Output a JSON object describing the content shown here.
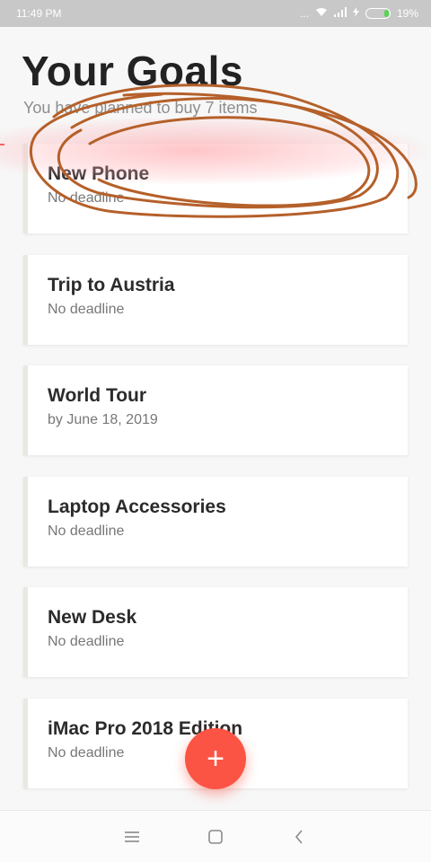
{
  "status_bar": {
    "time": "11:49 PM",
    "dots": "...",
    "battery_percent": "19%",
    "battery_level": 0.19
  },
  "header": {
    "title": "Your Goals",
    "subtitle": "You have planned to buy 7 items"
  },
  "goals": [
    {
      "title": "New Phone",
      "deadline": "No deadline"
    },
    {
      "title": "Trip to Austria",
      "deadline": "No deadline"
    },
    {
      "title": "World Tour",
      "deadline": "by June 18, 2019"
    },
    {
      "title": "Laptop Accessories",
      "deadline": "No deadline"
    },
    {
      "title": "New Desk",
      "deadline": "No deadline"
    },
    {
      "title": "iMac Pro 2018 Edition",
      "deadline": "No deadline"
    }
  ],
  "fab": {
    "label": "+",
    "icon": "plus-icon",
    "color": "#fb5444"
  },
  "nav": {
    "icons": [
      "menu-icon",
      "home-square-icon",
      "back-chevron-icon"
    ]
  },
  "colors": {
    "accent": "#fb5444",
    "progress": "#ff4a4a",
    "annotation": "#b5602a"
  }
}
